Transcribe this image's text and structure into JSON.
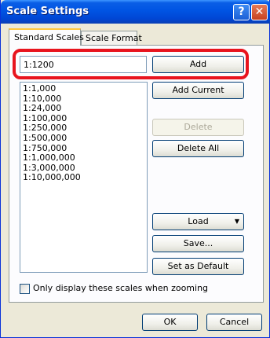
{
  "window": {
    "title": "Scale Settings",
    "help_glyph": "?",
    "close_glyph": "✕"
  },
  "tabs": [
    {
      "label": "Standard Scales",
      "active": true
    },
    {
      "label": "Scale Format",
      "active": false
    }
  ],
  "scale_input": {
    "value": "1:1200"
  },
  "buttons": {
    "add": "Add",
    "add_current": "Add Current",
    "delete": "Delete",
    "delete_all": "Delete All",
    "load": "Load",
    "save": "Save...",
    "set_default": "Set as Default",
    "ok": "OK",
    "cancel": "Cancel"
  },
  "scales": [
    "1:1,000",
    "1:10,000",
    "1:24,000",
    "1:100,000",
    "1:250,000",
    "1:500,000",
    "1:750,000",
    "1:1,000,000",
    "1:3,000,000",
    "1:10,000,000"
  ],
  "checkbox": {
    "label": "Only display these scales when zooming",
    "checked": false
  },
  "colors": {
    "highlight": "#e8141e",
    "title_bar": "#0054e3",
    "dialog_bg": "#ece9d8"
  }
}
